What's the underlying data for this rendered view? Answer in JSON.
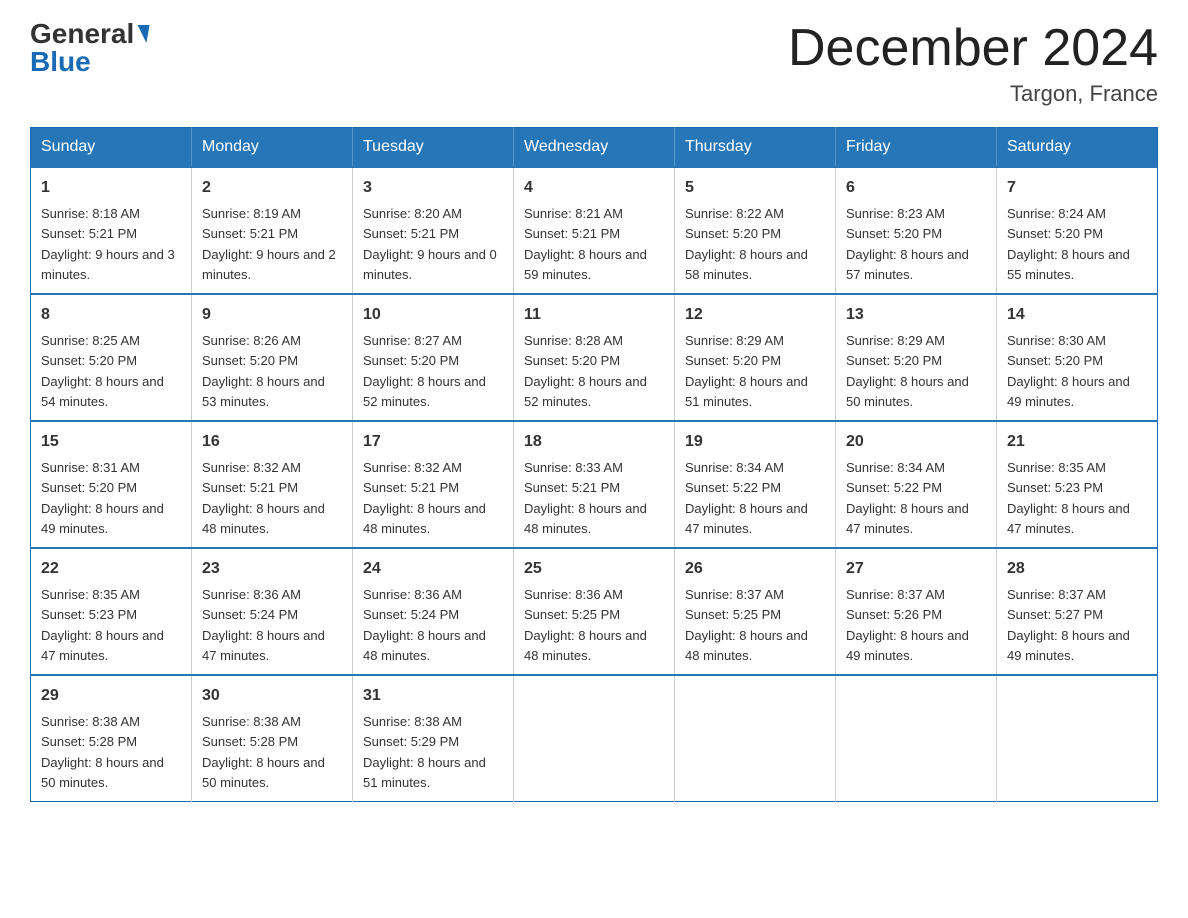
{
  "header": {
    "logo_general": "General",
    "logo_blue": "Blue",
    "title": "December 2024",
    "subtitle": "Targon, France"
  },
  "calendar": {
    "days_of_week": [
      "Sunday",
      "Monday",
      "Tuesday",
      "Wednesday",
      "Thursday",
      "Friday",
      "Saturday"
    ],
    "weeks": [
      [
        {
          "day": "1",
          "sunrise": "8:18 AM",
          "sunset": "5:21 PM",
          "daylight": "9 hours and 3 minutes."
        },
        {
          "day": "2",
          "sunrise": "8:19 AM",
          "sunset": "5:21 PM",
          "daylight": "9 hours and 2 minutes."
        },
        {
          "day": "3",
          "sunrise": "8:20 AM",
          "sunset": "5:21 PM",
          "daylight": "9 hours and 0 minutes."
        },
        {
          "day": "4",
          "sunrise": "8:21 AM",
          "sunset": "5:21 PM",
          "daylight": "8 hours and 59 minutes."
        },
        {
          "day": "5",
          "sunrise": "8:22 AM",
          "sunset": "5:20 PM",
          "daylight": "8 hours and 58 minutes."
        },
        {
          "day": "6",
          "sunrise": "8:23 AM",
          "sunset": "5:20 PM",
          "daylight": "8 hours and 57 minutes."
        },
        {
          "day": "7",
          "sunrise": "8:24 AM",
          "sunset": "5:20 PM",
          "daylight": "8 hours and 55 minutes."
        }
      ],
      [
        {
          "day": "8",
          "sunrise": "8:25 AM",
          "sunset": "5:20 PM",
          "daylight": "8 hours and 54 minutes."
        },
        {
          "day": "9",
          "sunrise": "8:26 AM",
          "sunset": "5:20 PM",
          "daylight": "8 hours and 53 minutes."
        },
        {
          "day": "10",
          "sunrise": "8:27 AM",
          "sunset": "5:20 PM",
          "daylight": "8 hours and 52 minutes."
        },
        {
          "day": "11",
          "sunrise": "8:28 AM",
          "sunset": "5:20 PM",
          "daylight": "8 hours and 52 minutes."
        },
        {
          "day": "12",
          "sunrise": "8:29 AM",
          "sunset": "5:20 PM",
          "daylight": "8 hours and 51 minutes."
        },
        {
          "day": "13",
          "sunrise": "8:29 AM",
          "sunset": "5:20 PM",
          "daylight": "8 hours and 50 minutes."
        },
        {
          "day": "14",
          "sunrise": "8:30 AM",
          "sunset": "5:20 PM",
          "daylight": "8 hours and 49 minutes."
        }
      ],
      [
        {
          "day": "15",
          "sunrise": "8:31 AM",
          "sunset": "5:20 PM",
          "daylight": "8 hours and 49 minutes."
        },
        {
          "day": "16",
          "sunrise": "8:32 AM",
          "sunset": "5:21 PM",
          "daylight": "8 hours and 48 minutes."
        },
        {
          "day": "17",
          "sunrise": "8:32 AM",
          "sunset": "5:21 PM",
          "daylight": "8 hours and 48 minutes."
        },
        {
          "day": "18",
          "sunrise": "8:33 AM",
          "sunset": "5:21 PM",
          "daylight": "8 hours and 48 minutes."
        },
        {
          "day": "19",
          "sunrise": "8:34 AM",
          "sunset": "5:22 PM",
          "daylight": "8 hours and 47 minutes."
        },
        {
          "day": "20",
          "sunrise": "8:34 AM",
          "sunset": "5:22 PM",
          "daylight": "8 hours and 47 minutes."
        },
        {
          "day": "21",
          "sunrise": "8:35 AM",
          "sunset": "5:23 PM",
          "daylight": "8 hours and 47 minutes."
        }
      ],
      [
        {
          "day": "22",
          "sunrise": "8:35 AM",
          "sunset": "5:23 PM",
          "daylight": "8 hours and 47 minutes."
        },
        {
          "day": "23",
          "sunrise": "8:36 AM",
          "sunset": "5:24 PM",
          "daylight": "8 hours and 47 minutes."
        },
        {
          "day": "24",
          "sunrise": "8:36 AM",
          "sunset": "5:24 PM",
          "daylight": "8 hours and 48 minutes."
        },
        {
          "day": "25",
          "sunrise": "8:36 AM",
          "sunset": "5:25 PM",
          "daylight": "8 hours and 48 minutes."
        },
        {
          "day": "26",
          "sunrise": "8:37 AM",
          "sunset": "5:25 PM",
          "daylight": "8 hours and 48 minutes."
        },
        {
          "day": "27",
          "sunrise": "8:37 AM",
          "sunset": "5:26 PM",
          "daylight": "8 hours and 49 minutes."
        },
        {
          "day": "28",
          "sunrise": "8:37 AM",
          "sunset": "5:27 PM",
          "daylight": "8 hours and 49 minutes."
        }
      ],
      [
        {
          "day": "29",
          "sunrise": "8:38 AM",
          "sunset": "5:28 PM",
          "daylight": "8 hours and 50 minutes."
        },
        {
          "day": "30",
          "sunrise": "8:38 AM",
          "sunset": "5:28 PM",
          "daylight": "8 hours and 50 minutes."
        },
        {
          "day": "31",
          "sunrise": "8:38 AM",
          "sunset": "5:29 PM",
          "daylight": "8 hours and 51 minutes."
        },
        {
          "day": "",
          "sunrise": "",
          "sunset": "",
          "daylight": ""
        },
        {
          "day": "",
          "sunrise": "",
          "sunset": "",
          "daylight": ""
        },
        {
          "day": "",
          "sunrise": "",
          "sunset": "",
          "daylight": ""
        },
        {
          "day": "",
          "sunrise": "",
          "sunset": "",
          "daylight": ""
        }
      ]
    ]
  }
}
